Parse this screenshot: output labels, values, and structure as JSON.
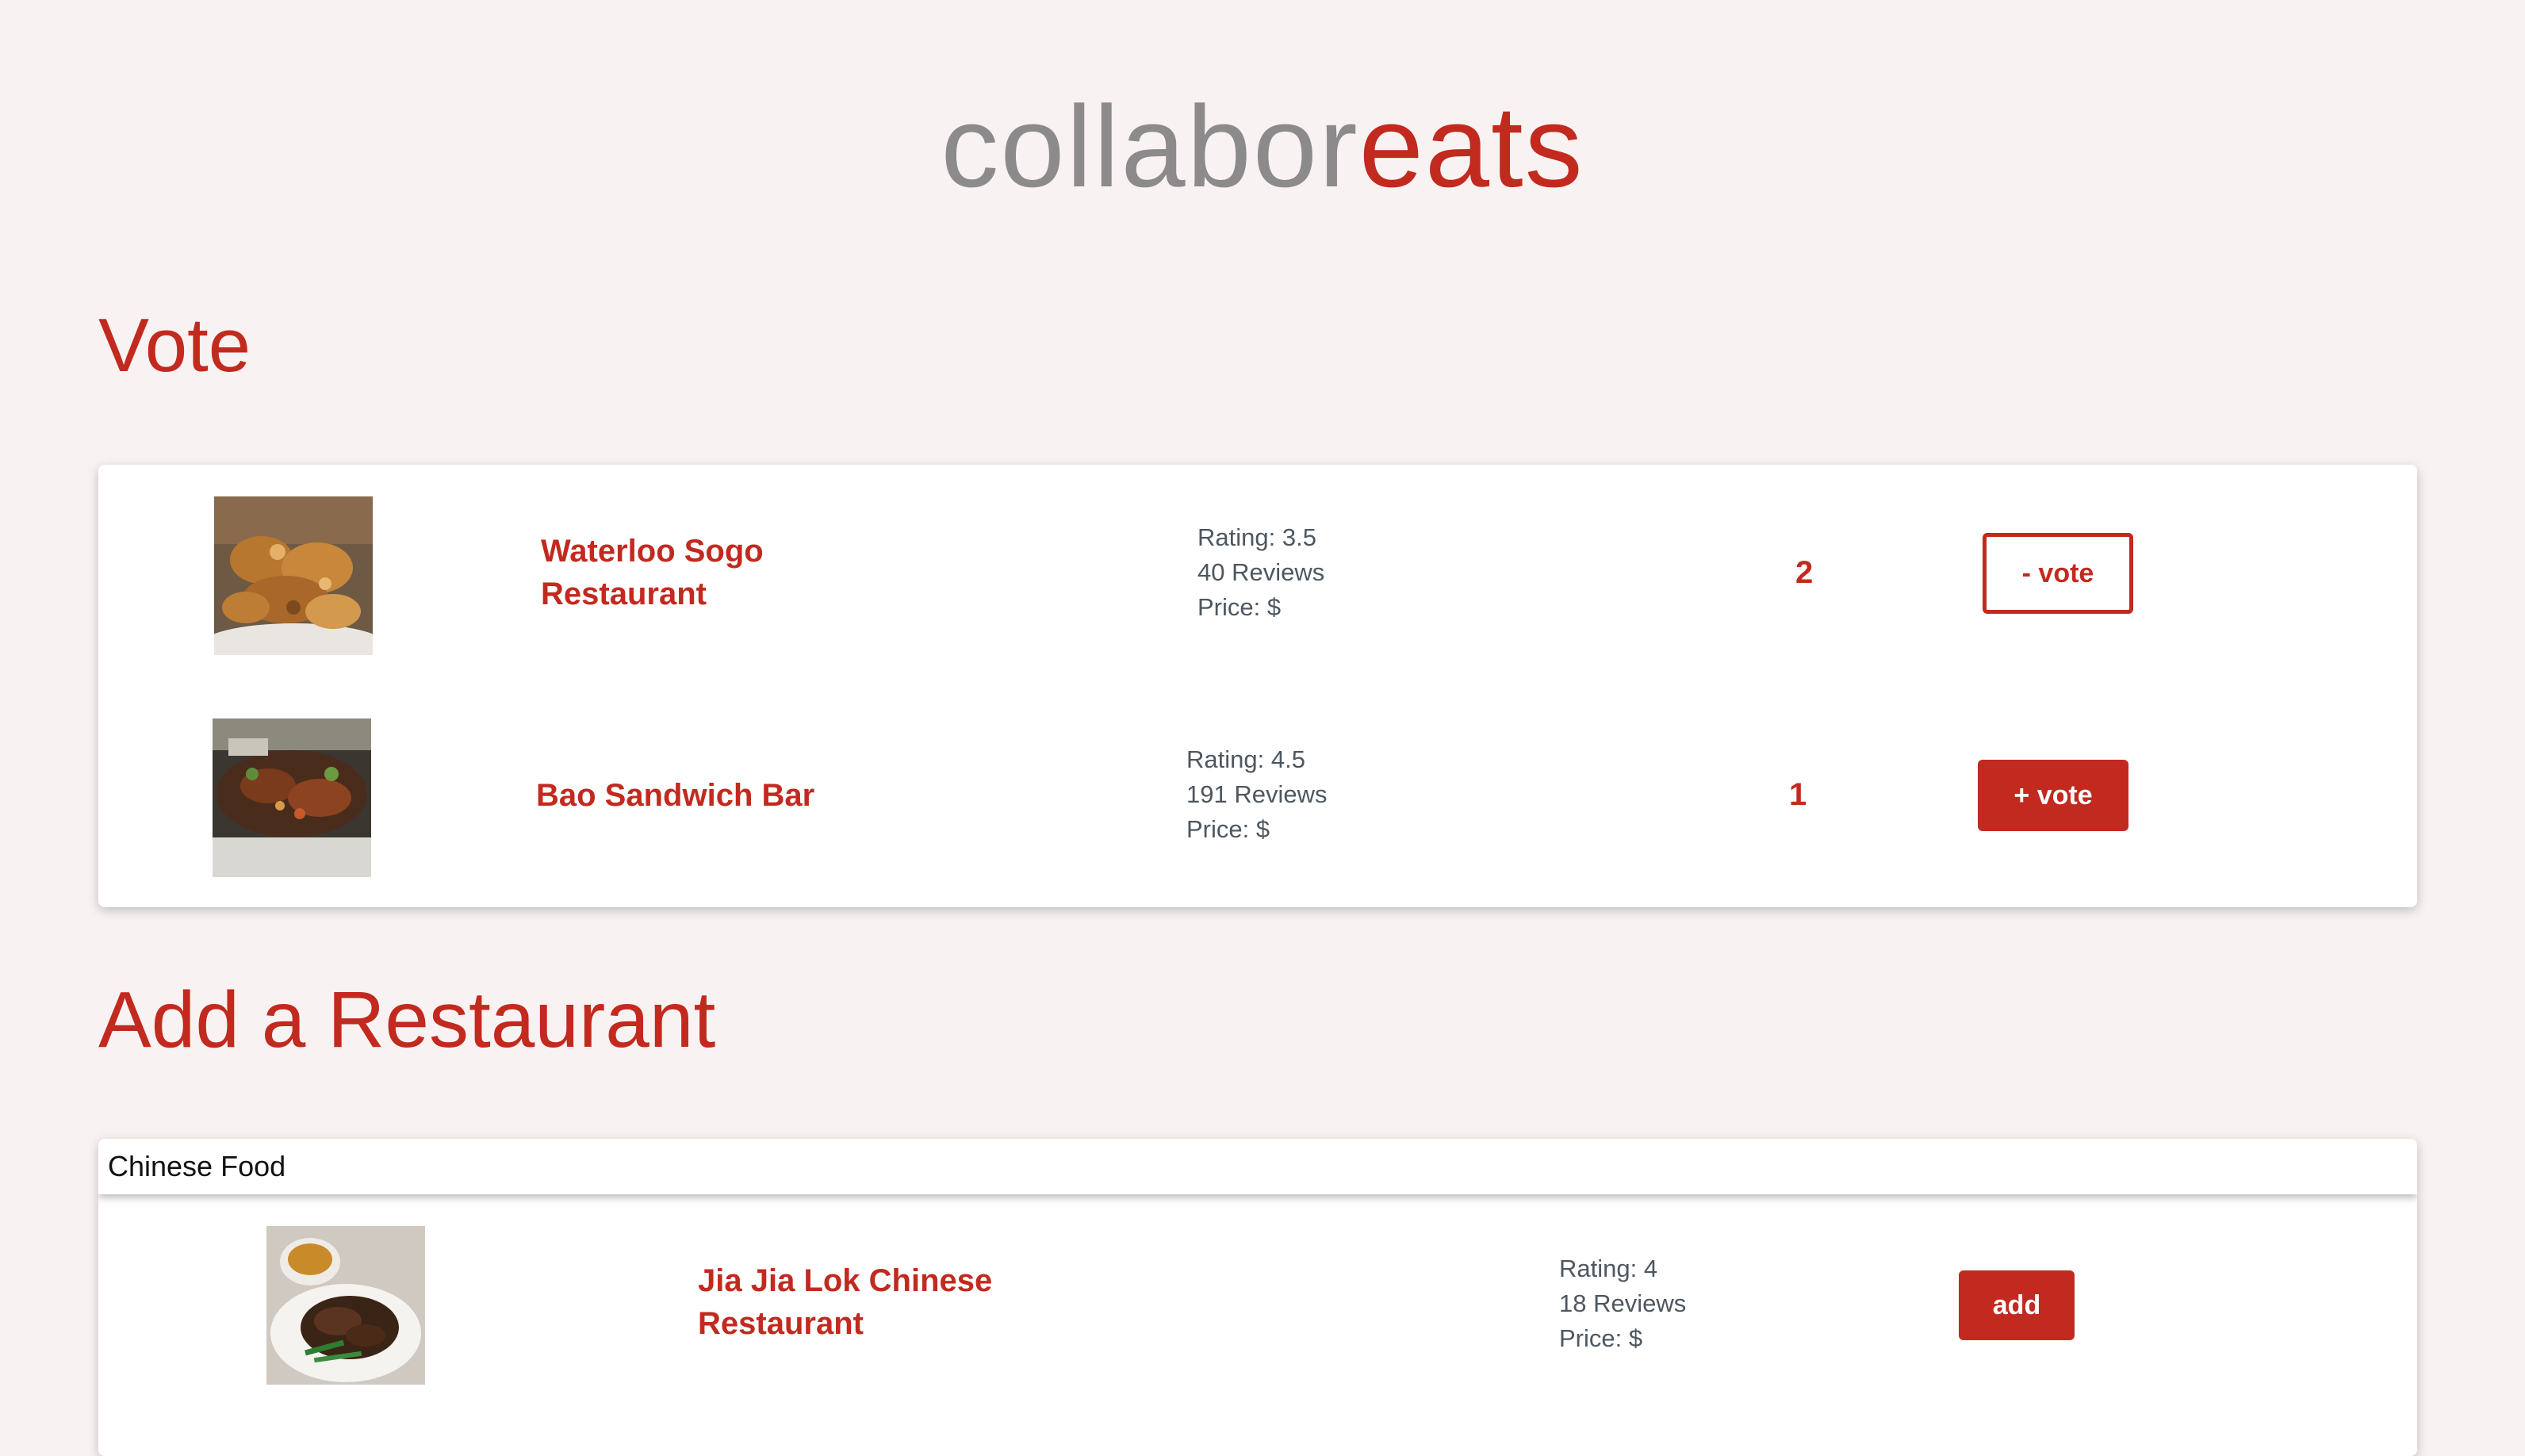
{
  "app": {
    "logo_part1": "collabor",
    "logo_part2": "eats"
  },
  "vote_section": {
    "title": "Vote",
    "items": [
      {
        "name": "Waterloo Sogo\nRestaurant",
        "rating": "Rating: 3.5",
        "reviews": "40 Reviews",
        "price": "Price: $",
        "votes": "2",
        "button_label": "- vote"
      },
      {
        "name": "Bao Sandwich Bar",
        "rating": "Rating: 4.5",
        "reviews": "191 Reviews",
        "price": "Price: $",
        "votes": "1",
        "button_label": "+ vote"
      }
    ]
  },
  "add_section": {
    "title": "Add a Restaurant",
    "search_value": "Chinese Food",
    "results": [
      {
        "name": "Jia Jia Lok Chinese\nRestaurant",
        "rating": "Rating: 4",
        "reviews": "18 Reviews",
        "price": "Price: $",
        "button_label": "add"
      }
    ]
  },
  "colors": {
    "accent": "#c22a1f",
    "logo_grey": "#8c8a8a",
    "background": "#f8f3f2",
    "stats_text": "#4e5760"
  }
}
